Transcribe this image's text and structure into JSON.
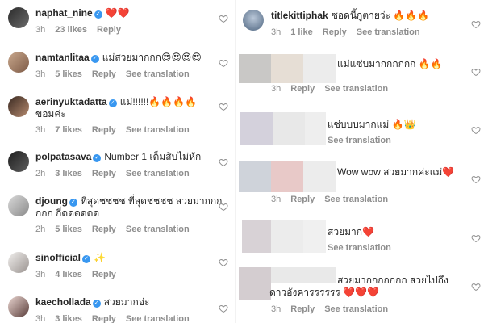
{
  "left": [
    {
      "user": "naphat_nine",
      "text": "❤️❤️",
      "time": "3h",
      "likes": "23 likes",
      "reply": "Reply",
      "translate": ""
    },
    {
      "user": "namtanlitaa",
      "text": "แม่สวยมากกก😍😍😍😍",
      "time": "3h",
      "likes": "5 likes",
      "reply": "Reply",
      "translate": "See translation"
    },
    {
      "user": "aerinyuktadatta",
      "text": "แม่!!!!!!🔥🔥🔥🔥",
      "text2": "ขอมค่ะ",
      "time": "3h",
      "likes": "7 likes",
      "reply": "Reply",
      "translate": "See translation"
    },
    {
      "user": "polpatasava",
      "text": "Number 1 เต็มสิบไม่หัก",
      "time": "2h",
      "likes": "3 likes",
      "reply": "Reply",
      "translate": "See translation"
    },
    {
      "user": "djoung",
      "text": "ที่สุดชชชช ที่สุดชชชช สวยมากกก",
      "text2": "กกก กี่ดดดดดด",
      "time": "2h",
      "likes": "5 likes",
      "reply": "Reply",
      "translate": "See translation"
    },
    {
      "user": "sinofficial",
      "text": "✨",
      "time": "3h",
      "likes": "4 likes",
      "reply": "Reply",
      "translate": ""
    },
    {
      "user": "kaechollada",
      "text": "สวยมากอ่ะ",
      "time": "3h",
      "likes": "3 likes",
      "reply": "Reply",
      "translate": "See translation"
    }
  ],
  "right": [
    {
      "user": "titlekittiphak",
      "text": "ซอดนี้กูตายว่ะ 🔥🔥🔥",
      "time": "3h",
      "likes": "1 like",
      "reply": "Reply",
      "translate": "See translation"
    },
    {
      "text": "แม่แซ่บมากกกกกก 🔥🔥",
      "time": "3h",
      "reply": "Reply",
      "translate": "See translation"
    },
    {
      "text": "แซ่บบบมากแม่ 🔥👑",
      "translate": "See translation"
    },
    {
      "text": "Wow wow สวยมากค่ะแม่❤️",
      "time": "3h",
      "reply": "Reply",
      "translate": "See translation"
    },
    {
      "text": "สวยมาก❤️",
      "translate": "See translation"
    },
    {
      "text": "สวยมากกกกกกก สวยไปถึง",
      "text2": "ดาวอังคารรรรรร ❤️❤️❤️",
      "time": "3h",
      "reply": "Reply",
      "translate": "See translation"
    }
  ],
  "colors": {
    "verified": "#3897f0",
    "meta": "#8e8e8e",
    "heart_outline": "#262626"
  }
}
